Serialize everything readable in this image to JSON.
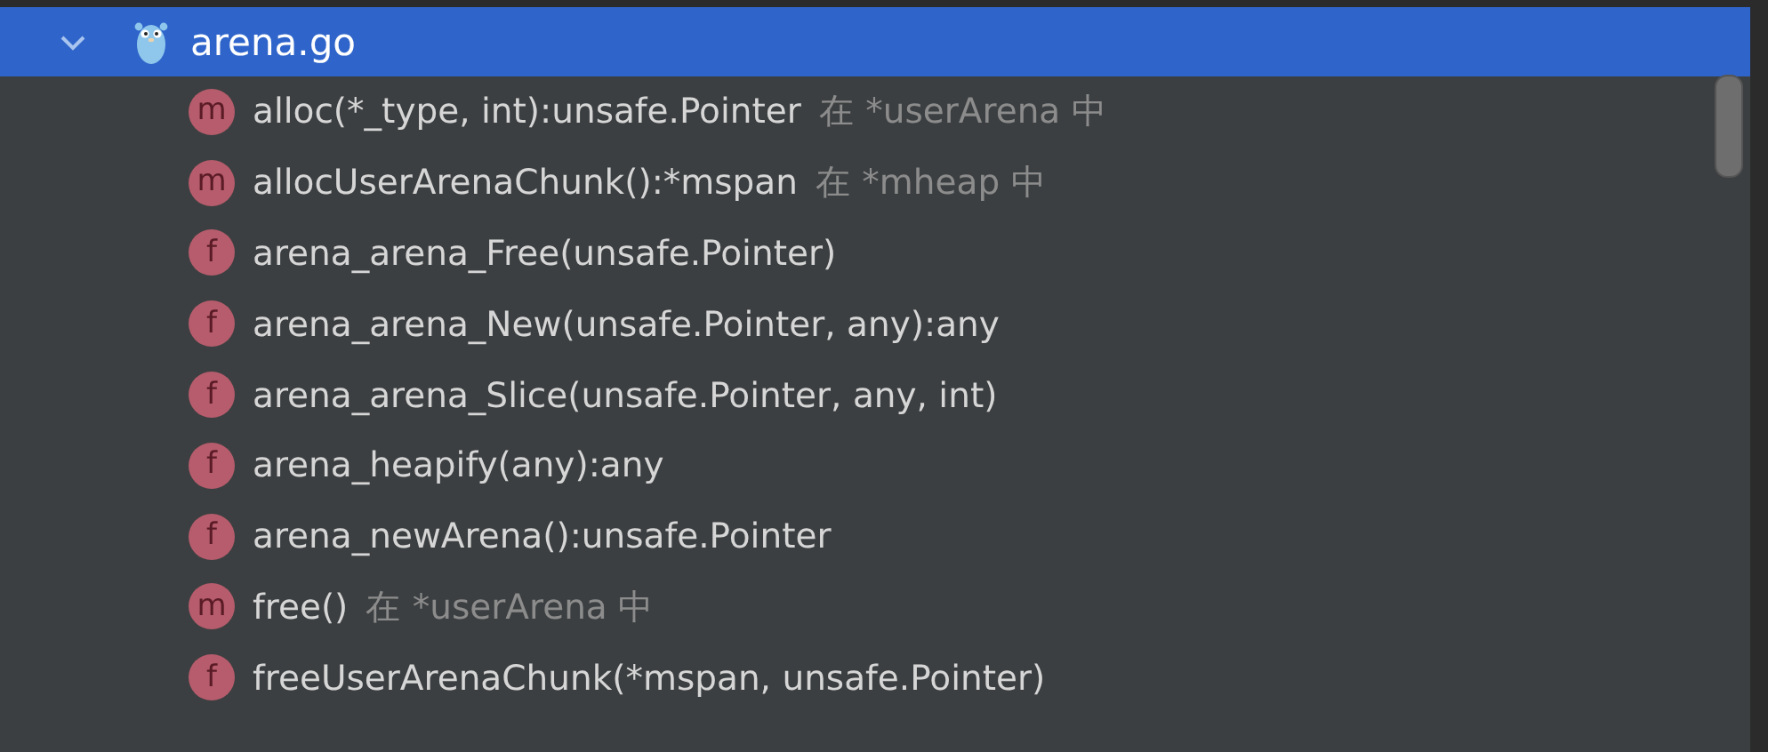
{
  "file": {
    "name": "arena.go",
    "expanded": true,
    "selected": true
  },
  "items": [
    {
      "badge": "m",
      "name": "alloc(*_type, int):unsafe.Pointer",
      "location": "在 *userArena 中"
    },
    {
      "badge": "m",
      "name": "allocUserArenaChunk():*mspan",
      "location": "在 *mheap 中"
    },
    {
      "badge": "f",
      "name": "arena_arena_Free(unsafe.Pointer)"
    },
    {
      "badge": "f",
      "name": "arena_arena_New(unsafe.Pointer, any):any"
    },
    {
      "badge": "f",
      "name": "arena_arena_Slice(unsafe.Pointer, any, int)"
    },
    {
      "badge": "f",
      "name": "arena_heapify(any):any"
    },
    {
      "badge": "f",
      "name": "arena_newArena():unsafe.Pointer"
    },
    {
      "badge": "m",
      "name": "free()",
      "location": "在 *userArena 中"
    },
    {
      "badge": "f",
      "name": "freeUserArenaChunk(*mspan, unsafe.Pointer)"
    }
  ]
}
